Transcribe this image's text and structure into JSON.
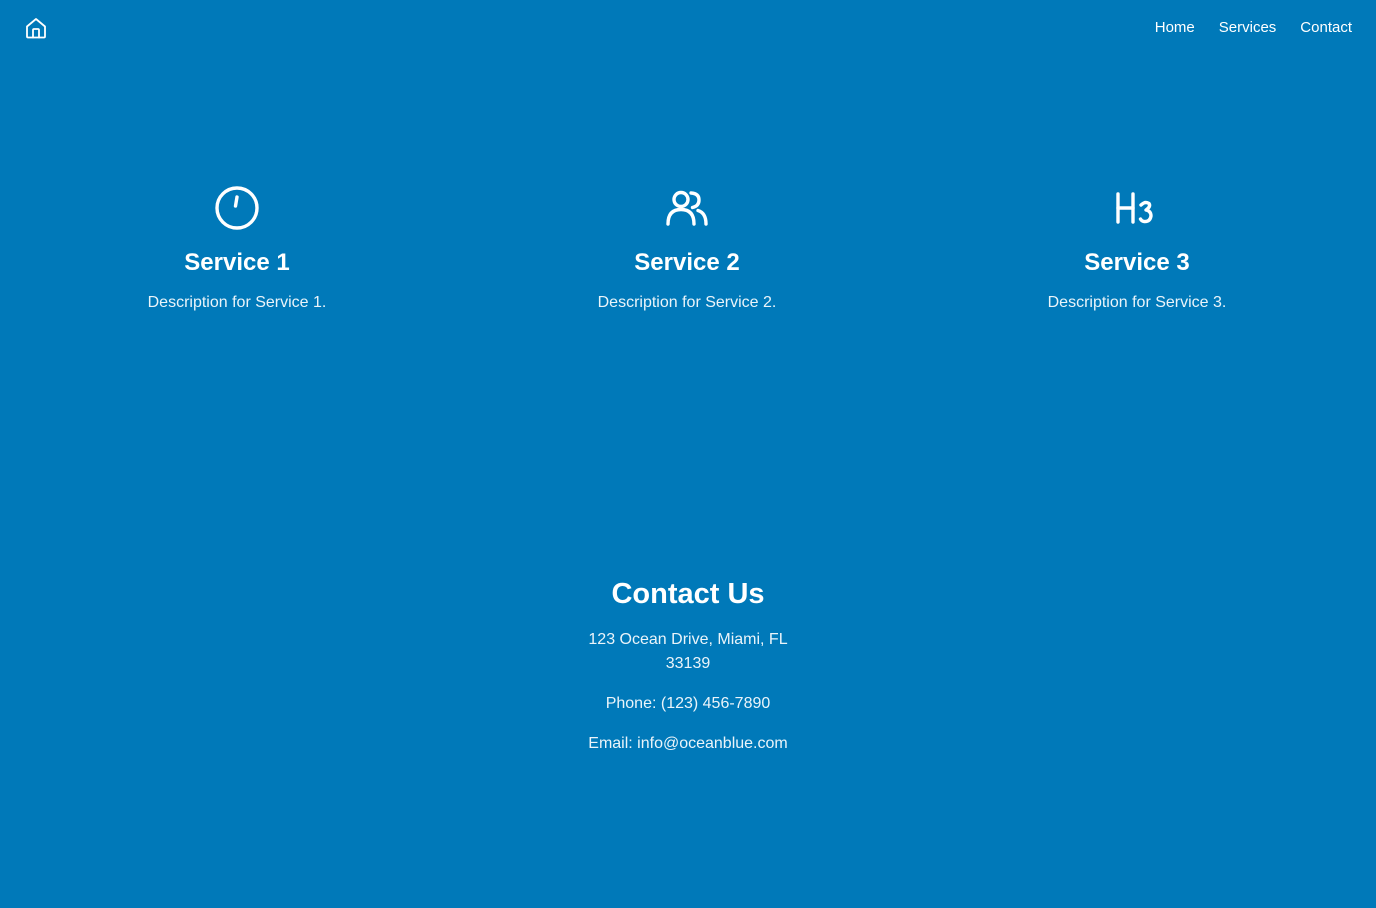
{
  "header": {
    "logo_icon": "home-icon",
    "nav": [
      {
        "label": "Home"
      },
      {
        "label": "Services"
      },
      {
        "label": "Contact"
      }
    ]
  },
  "services": [
    {
      "icon": "clock-icon",
      "title": "Service 1",
      "description": "Description for Service 1."
    },
    {
      "icon": "users-icon",
      "title": "Service 2",
      "description": "Description for Service 2."
    },
    {
      "icon": "heading-3-icon",
      "title": "Service 3",
      "description": "Description for Service 3."
    }
  ],
  "contact": {
    "title": "Contact Us",
    "address": "123 Ocean Drive, Miami, FL 33139",
    "phone": "Phone: (123) 456-7890",
    "email": "Email: info@oceanblue.com"
  },
  "colors": {
    "background": "#0079b9",
    "text": "#ffffff"
  }
}
